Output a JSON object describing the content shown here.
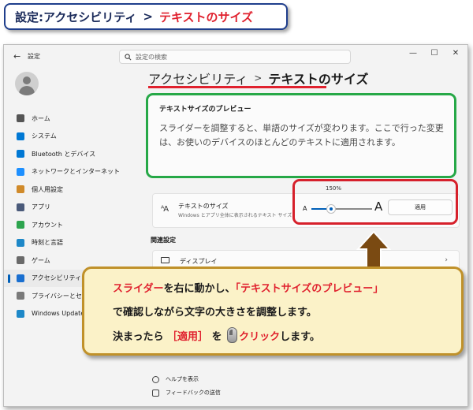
{
  "banner": {
    "part1": "設定:アクセシビリティ",
    "separator": ">",
    "part2": "テキストのサイズ"
  },
  "window": {
    "app_title": "設定",
    "search_placeholder": "設定の検索",
    "controls": {
      "minimize": "—",
      "maximize": "☐",
      "close": "✕"
    }
  },
  "sidebar": {
    "items": [
      {
        "label": "ホーム",
        "icon": "home-icon",
        "color": "#555555"
      },
      {
        "label": "システム",
        "icon": "system-icon",
        "color": "#0078d4"
      },
      {
        "label": "Bluetooth とデバイス",
        "icon": "bluetooth-icon",
        "color": "#0078d4"
      },
      {
        "label": "ネットワークとインターネット",
        "icon": "network-icon",
        "color": "#1e90ff"
      },
      {
        "label": "個人用設定",
        "icon": "brush-icon",
        "color": "#d08a2a"
      },
      {
        "label": "アプリ",
        "icon": "apps-icon",
        "color": "#4a5a7a"
      },
      {
        "label": "アカウント",
        "icon": "account-icon",
        "color": "#2da44e"
      },
      {
        "label": "時刻と言語",
        "icon": "time-language-icon",
        "color": "#1e88c8"
      },
      {
        "label": "ゲーム",
        "icon": "game-icon",
        "color": "#6a6a6a"
      },
      {
        "label": "アクセシビリティ",
        "icon": "accessibility-icon",
        "color": "#1a6fd0"
      },
      {
        "label": "プライバシーとセキュリティ",
        "icon": "shield-icon",
        "color": "#7a7a7a"
      },
      {
        "label": "Windows Update",
        "icon": "update-icon",
        "color": "#1e88c8"
      }
    ],
    "active_index": 9
  },
  "breadcrumb": {
    "parent": "アクセシビリティ",
    "separator": ">",
    "current": "テキストのサイズ"
  },
  "preview": {
    "title": "テキストサイズのプレビュー",
    "text": "スライダーを調整すると、単語のサイズが変わります。ここで行った変更は、お使いのデバイスのほとんどのテキストに適用されます。"
  },
  "text_size": {
    "label": "テキストのサイズ",
    "description": "Windows とアプリ全体に表示されるテキスト サイズ",
    "percent": "150%",
    "small_a": "A",
    "large_a": "A",
    "slider_value": 0.33,
    "apply_label": "適用"
  },
  "related": {
    "heading": "関連設定",
    "display_label": "ディスプレイ"
  },
  "footer": {
    "help": "ヘルプを表示",
    "feedback": "フィードバックの送信"
  },
  "callout": {
    "l1_red1": "スライダー",
    "l1_t1": "を右に動かし、",
    "l1_red2": "「テキストサイズのプレビュー」",
    "l2": "で確認しながら文字の大きさを調整します。",
    "l3_t1": "決まったら",
    "l3_red": "［適用］",
    "l3_t2": "を",
    "l3_red2": "クリック",
    "l3_t3": "します。"
  },
  "colors": {
    "accent": "#005fb8",
    "highlight_red": "#e0212e",
    "highlight_green": "#26a847",
    "callout_bg": "#fbf2c8",
    "arrow_brown": "#7a4a12"
  }
}
